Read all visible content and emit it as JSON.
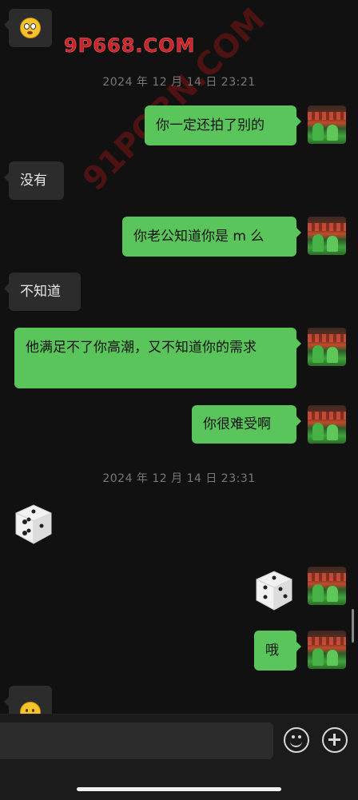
{
  "watermark": "9P668.COM",
  "watermark_diag": "91PORN.COM",
  "timestamps": [
    "2024 年 12 月 14 日 23:21",
    "2024 年 12 月 14 日 23:31"
  ],
  "messages": [
    {
      "side": "out",
      "text": "你一定还拍了别的"
    },
    {
      "side": "in",
      "text": "没有"
    },
    {
      "side": "out",
      "text": "你老公知道你是 m 么"
    },
    {
      "side": "in",
      "text": "不知道"
    },
    {
      "side": "out",
      "text": "他满足不了你高潮，又不知道你的需求"
    },
    {
      "side": "out",
      "text": "你很难受啊"
    },
    {
      "side": "out",
      "text": "哦"
    }
  ],
  "icons": {
    "emoji_top": "flushed-face-emoji",
    "emoji_bottom": "thinking-face-emoji",
    "dice_in": "dice-emoji",
    "dice_out": "dice-emoji"
  },
  "colors": {
    "out_bubble": "#5ac55a",
    "in_bubble": "#2c2c2c",
    "background": "#111111"
  }
}
